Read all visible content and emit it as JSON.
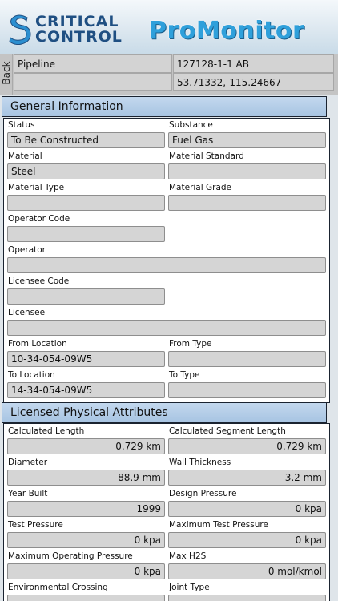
{
  "header": {
    "logo_line1": "CRITICAL",
    "logo_line2": "CONTROL",
    "app_title": "ProMonitor"
  },
  "infobar": {
    "back_label": "Back",
    "type_label": "Pipeline",
    "id_value": "127128-1-1 AB",
    "blank_value": "",
    "coordinates": "53.71332,-115.24667"
  },
  "general": {
    "title": "General Information",
    "status_label": "Status",
    "status_value": "To Be Constructed",
    "substance_label": "Substance",
    "substance_value": "Fuel Gas",
    "material_label": "Material",
    "material_value": "Steel",
    "material_standard_label": "Material Standard",
    "material_standard_value": "",
    "material_type_label": "Material Type",
    "material_type_value": "",
    "material_grade_label": "Material Grade",
    "material_grade_value": "",
    "operator_code_label": "Operator Code",
    "operator_code_value": "",
    "operator_label": "Operator",
    "operator_value": "",
    "licensee_code_label": "Licensee Code",
    "licensee_code_value": "",
    "licensee_label": "Licensee",
    "licensee_value": "",
    "from_location_label": "From Location",
    "from_location_value": "10-34-054-09W5",
    "from_type_label": "From Type",
    "from_type_value": "",
    "to_location_label": "To Location",
    "to_location_value": "14-34-054-09W5",
    "to_type_label": "To Type",
    "to_type_value": ""
  },
  "physical": {
    "title": "Licensed Physical Attributes",
    "calc_length_label": "Calculated Length",
    "calc_length_value": "0.729 km",
    "calc_segment_label": "Calculated Segment Length",
    "calc_segment_value": "0.729 km",
    "diameter_label": "Diameter",
    "diameter_value": "88.9 mm",
    "wall_thickness_label": "Wall Thickness",
    "wall_thickness_value": "3.2 mm",
    "year_built_label": "Year Built",
    "year_built_value": "1999",
    "design_pressure_label": "Design Pressure",
    "design_pressure_value": "0 kpa",
    "test_pressure_label": "Test Pressure",
    "test_pressure_value": "0 kpa",
    "max_test_pressure_label": "Maximum Test Pressure",
    "max_test_pressure_value": "0 kpa",
    "max_operating_label": "Maximum Operating Pressure",
    "max_operating_value": "0 kpa",
    "max_h2s_label": "Max H2S",
    "max_h2s_value": "0 mol/kmol",
    "env_crossing_label": "Environmental Crossing",
    "joint_type_label": "Joint Type"
  },
  "colors": {
    "brand_dark": "#1f4f82",
    "brand_light": "#2fa0db",
    "section_header": "#b6cde8",
    "field_bg": "#d5d5d5"
  }
}
